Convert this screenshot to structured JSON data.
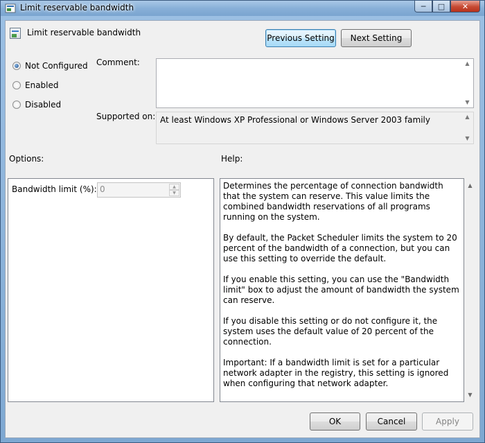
{
  "window": {
    "title": "Limit reservable bandwidth"
  },
  "header": {
    "setting_name": "Limit reservable bandwidth",
    "previous_label": "Previous Setting",
    "next_label": "Next Setting"
  },
  "state_options": [
    {
      "label": "Not Configured",
      "checked": true
    },
    {
      "label": "Enabled",
      "checked": false
    },
    {
      "label": "Disabled",
      "checked": false
    }
  ],
  "comment": {
    "label": "Comment:",
    "value": ""
  },
  "supported": {
    "label": "Supported on:",
    "value": "At least Windows XP Professional or Windows Server 2003 family"
  },
  "options": {
    "label": "Options:",
    "bandwidth_label": "Bandwidth limit (%):",
    "bandwidth_value": "0"
  },
  "help": {
    "label": "Help:",
    "paragraphs": [
      "Determines the percentage of connection bandwidth that the system can reserve. This value limits the combined bandwidth reservations of all programs running on the system.",
      "By default, the Packet Scheduler limits the system to 20 percent of the bandwidth of a connection, but you can use this setting to override the default.",
      "If you enable this setting, you can use the \"Bandwidth limit\" box to adjust the amount of bandwidth the system can reserve.",
      "If you disable this setting or do not configure it, the system uses the default value of 20 percent of the connection.",
      "Important: If a bandwidth limit is set for a particular network adapter in the registry, this setting is ignored when configuring that network adapter."
    ]
  },
  "footer": {
    "ok_label": "OK",
    "cancel_label": "Cancel",
    "apply_label": "Apply"
  },
  "colors": {
    "accent": "#3c7fb1",
    "dialog_bg": "#f0f0f0",
    "close_button": "#c64a33"
  }
}
